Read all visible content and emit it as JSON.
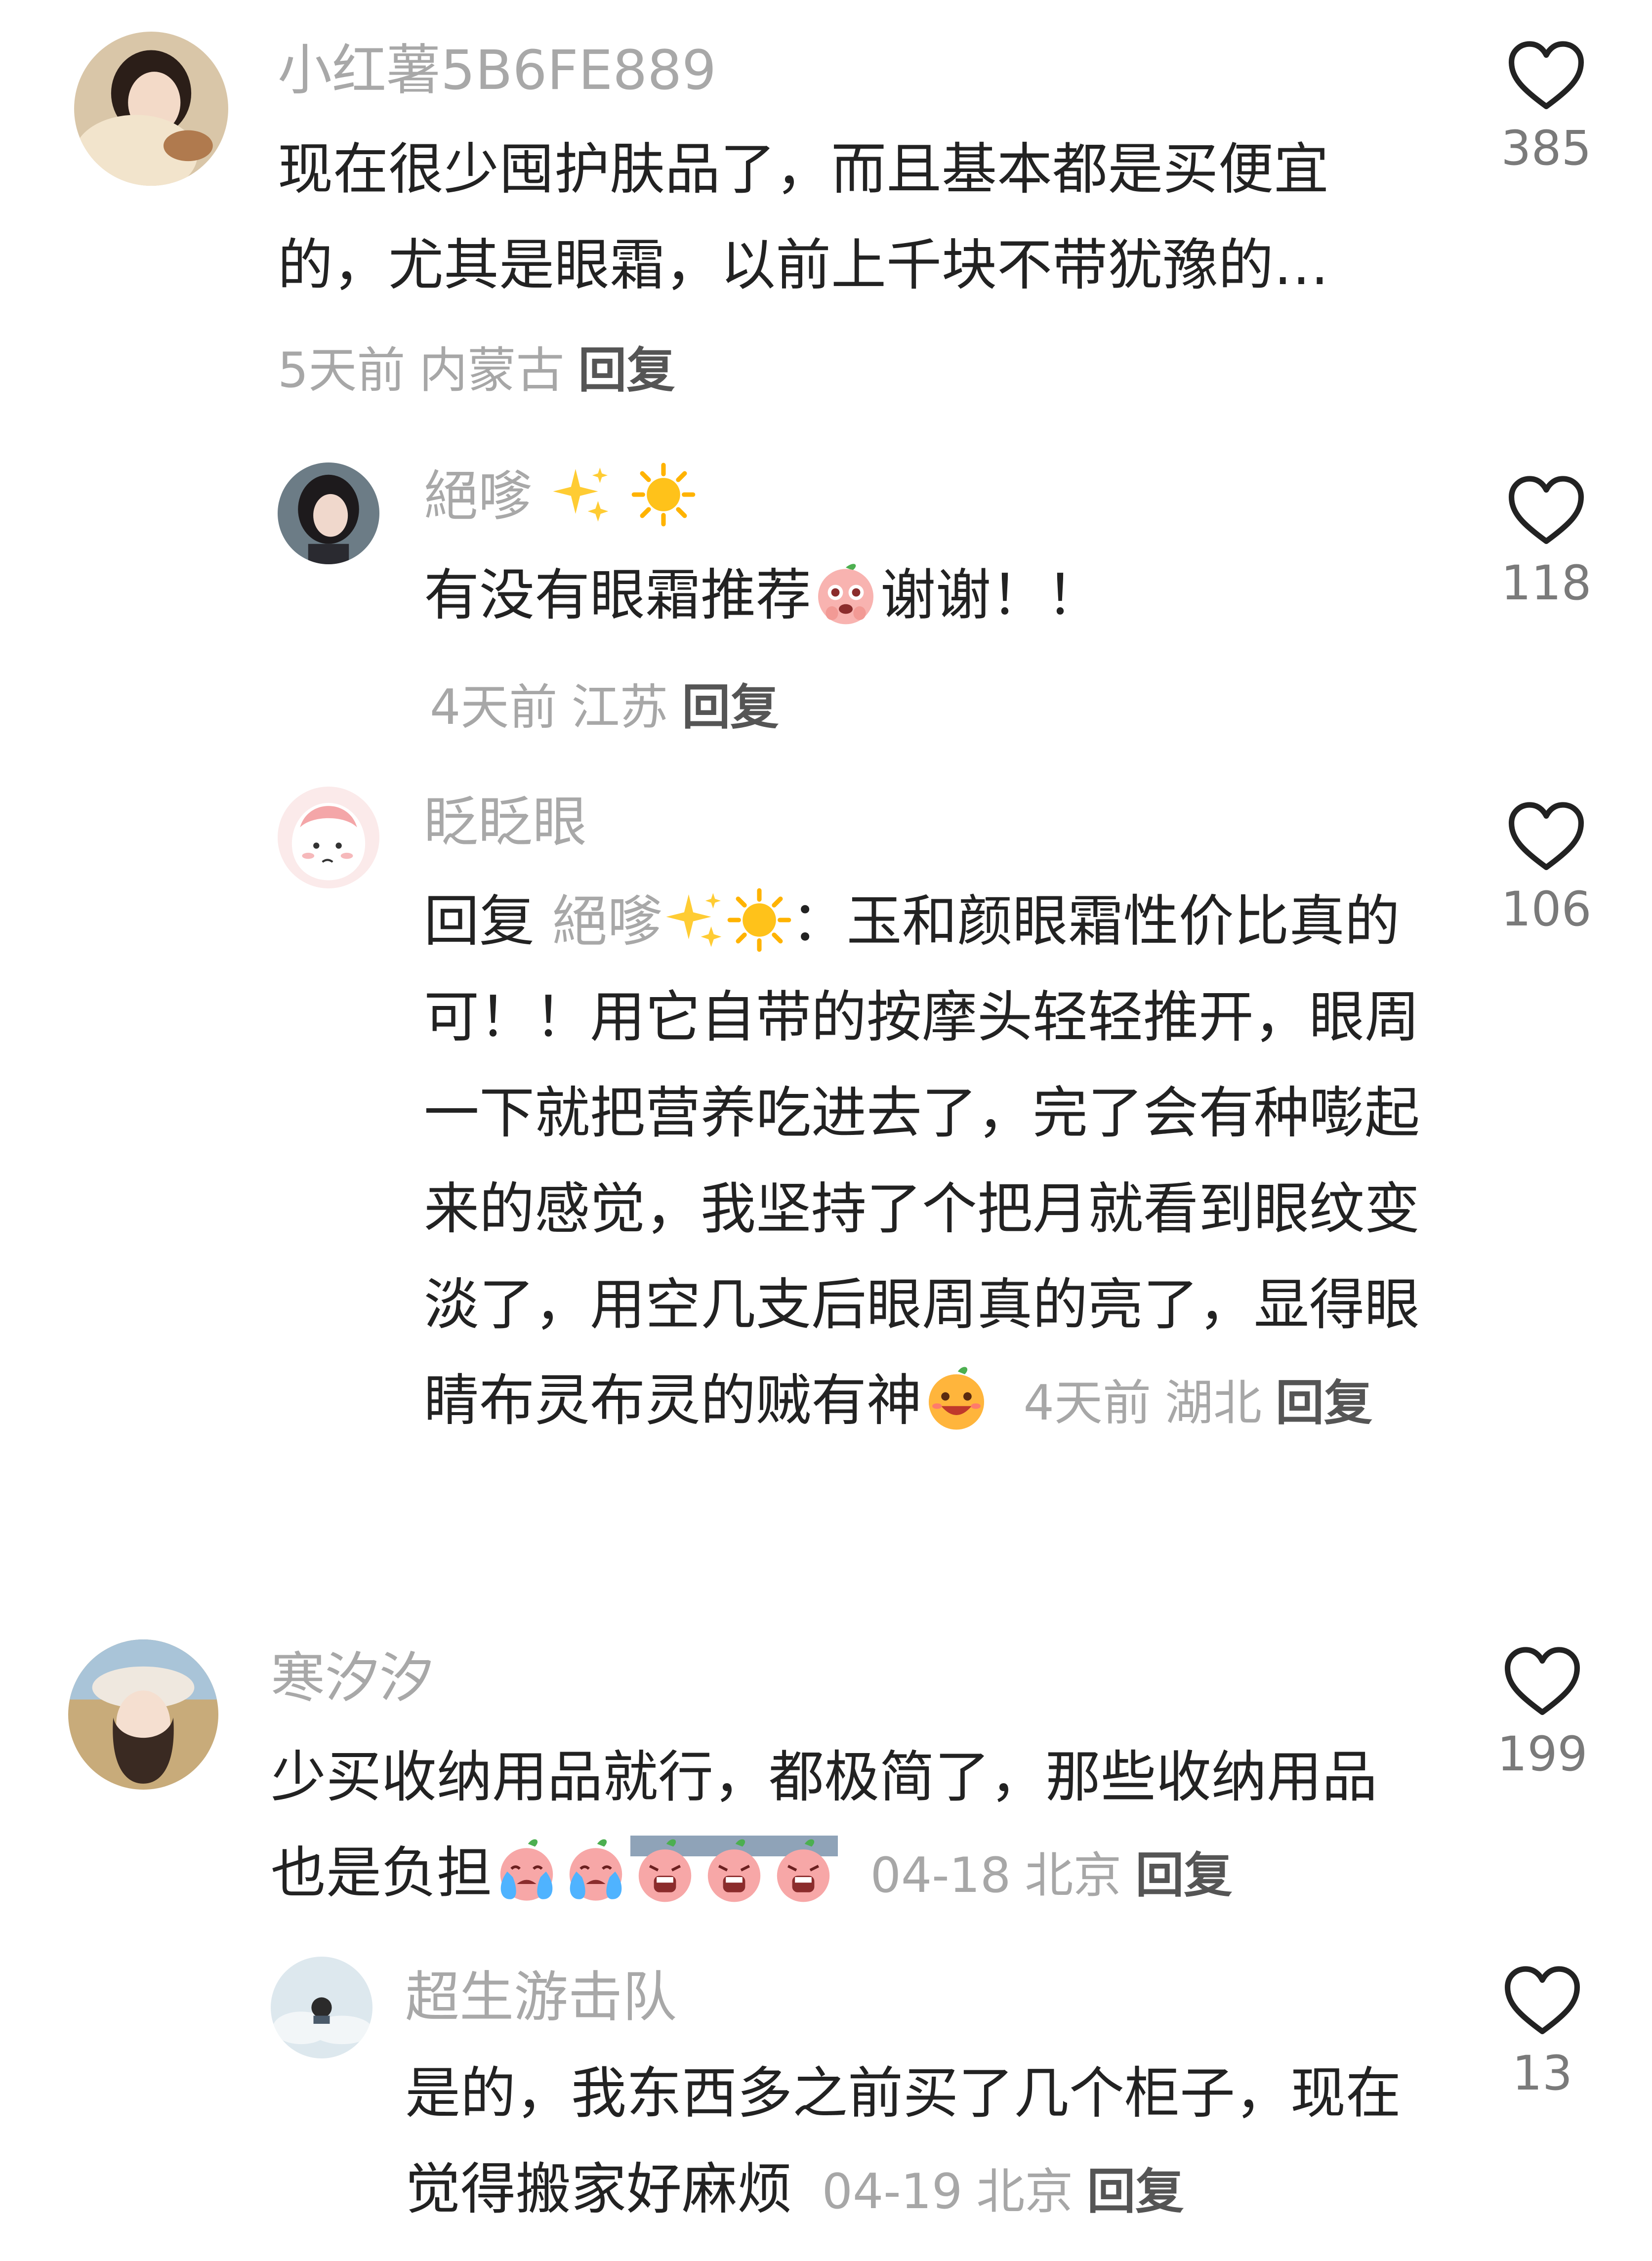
{
  "comments": [
    {
      "username": "小红薯5B6FE889",
      "text": "现在很少囤护肤品了，而且基本都是买便宜的，尤其是眼霜，以前上千块不带犹豫的…",
      "time": "5天前",
      "location": "内蒙古",
      "reply_label": "回复",
      "likes": "385"
    },
    {
      "username": "絕嗲",
      "text_a": "有没有眼霜推荐",
      "text_b": "谢谢！！",
      "time": "4天前",
      "location": "江苏",
      "reply_label": "回复",
      "likes": "118"
    },
    {
      "username": "眨眨眼",
      "reply_prefix": "回复",
      "reply_to": "絕嗲",
      "text": "：玉和颜眼霜性价比真的可！！用它自带的按摩头轻轻推开，眼周一下就把营养吃进去了，完了会有种嘭起来的感觉，我坚持了个把月就看到眼纹变淡了，用空几支后眼周真的亮了，显得眼睛布灵布灵的贼有神",
      "time": "4天前",
      "location": "湖北",
      "reply_label": "回复",
      "likes": "106"
    },
    {
      "username": "寒汐汐",
      "text": "少买收纳用品就行，都极简了，那些收纳用品也是负担",
      "time": "04-18",
      "location": "北京",
      "reply_label": "回复",
      "likes": "199"
    },
    {
      "username": "超生游击队",
      "text": "是的，我东西多之前买了几个柜子，现在觉得搬家好麻烦",
      "time": "04-19",
      "location": "北京",
      "reply_label": "回复",
      "likes": "13"
    }
  ],
  "icons": {
    "like": "heart-outline-icon",
    "sparkles": "sparkles-emoji",
    "sun": "sun-emoji",
    "pleading": "pleading-peach-emoji",
    "grin": "grin-peach-emoji",
    "crying": "crying-peach-emoji",
    "scream": "scream-peach-emoji"
  }
}
